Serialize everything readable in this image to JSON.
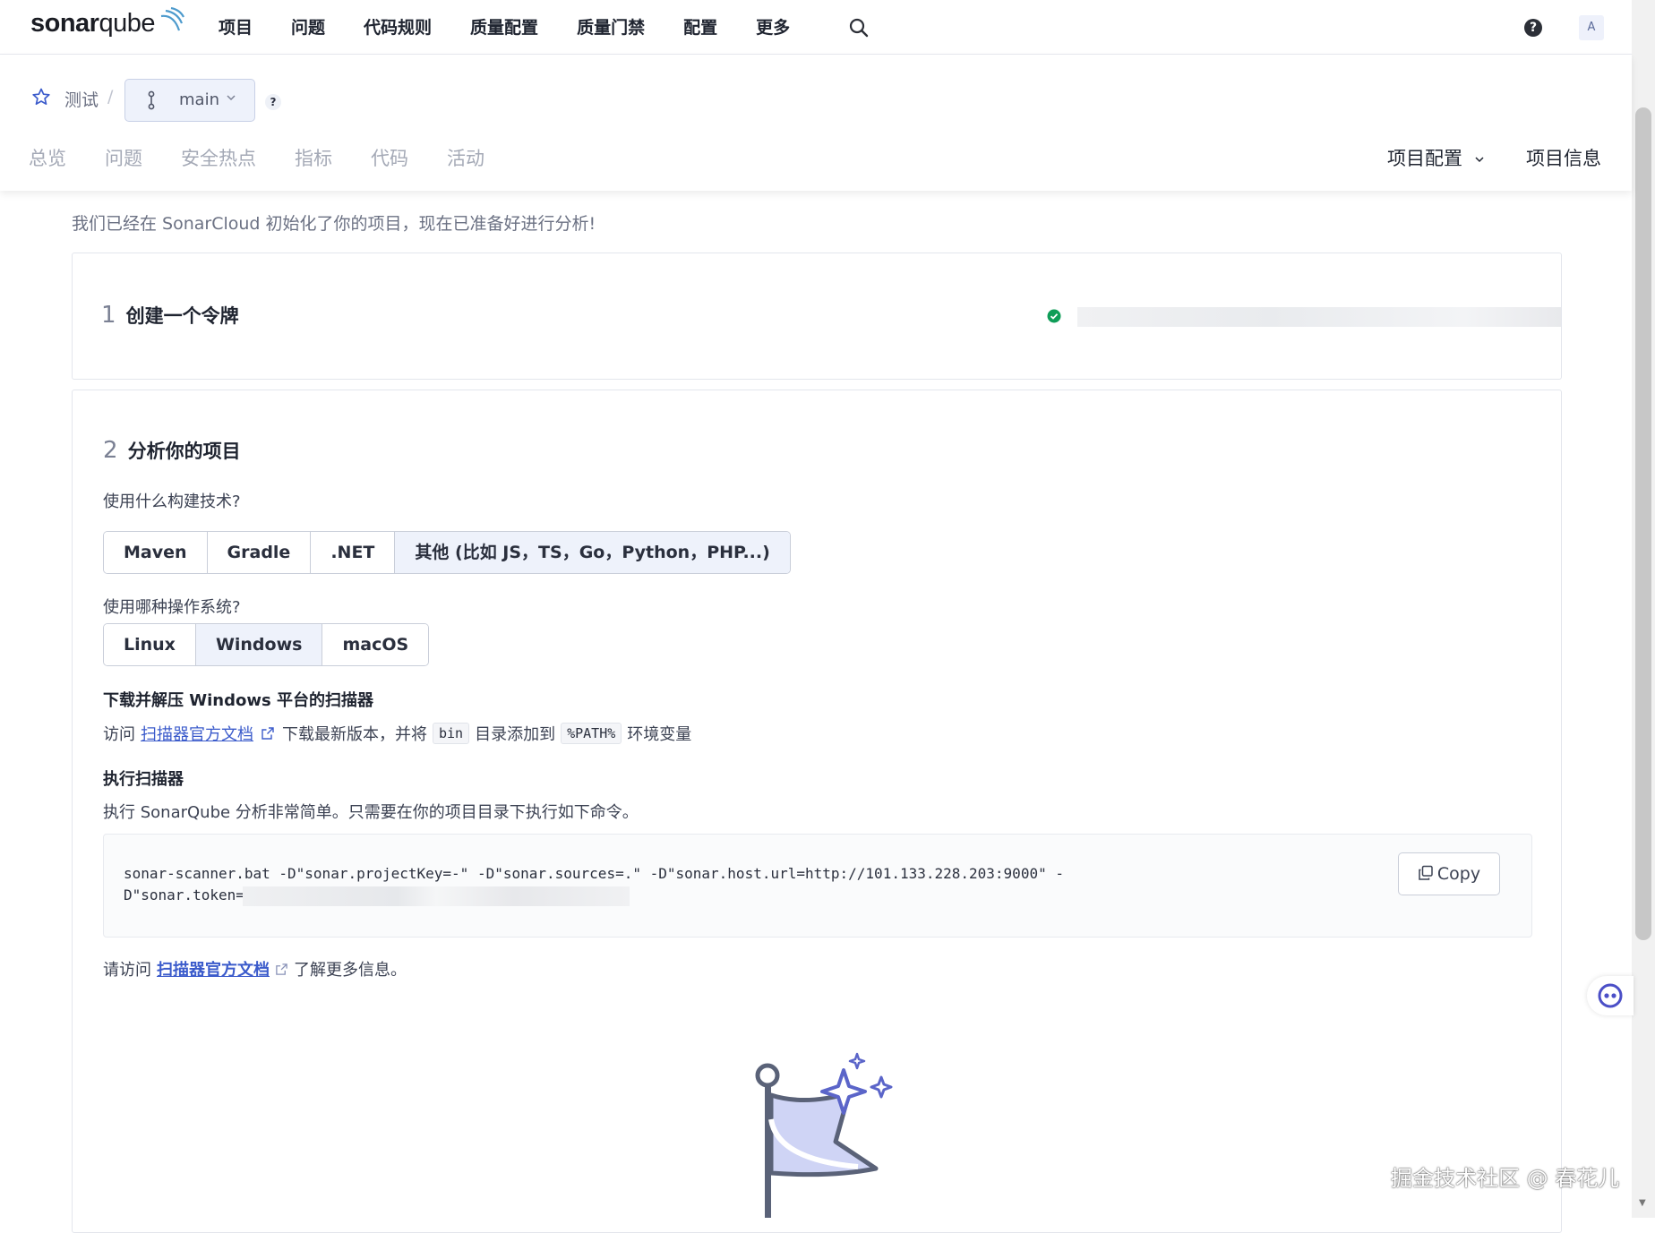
{
  "app": {
    "logo_text_bold": "sonar",
    "logo_text_light": "qube"
  },
  "topnav": {
    "items": [
      "项目",
      "问题",
      "代码规则",
      "质量配置",
      "质量门禁",
      "配置",
      "更多"
    ],
    "avatar": "A"
  },
  "project": {
    "name": "测试",
    "branch": "main",
    "help_mark": "?",
    "tabs": [
      "总览",
      "问题",
      "安全热点",
      "指标",
      "代码",
      "活动"
    ],
    "config_label": "项目配置",
    "info_label": "项目信息"
  },
  "intro": "我们已经在 SonarCloud 初始化了你的项目，现在已准备好进行分析!",
  "step1": {
    "num": "1",
    "title": "创建一个令牌"
  },
  "step2": {
    "num": "2",
    "title": "分析你的项目",
    "build_question": "使用什么构建技术?",
    "build_options": [
      "Maven",
      "Gradle",
      ".NET",
      "其他 (比如 JS，TS，Go，Python，PHP...)"
    ],
    "build_selected": "其他 (比如 JS，TS，Go，Python，PHP...)",
    "os_question": "使用哪种操作系统?",
    "os_options": [
      "Linux",
      "Windows",
      "macOS"
    ],
    "os_selected": "Windows",
    "download_title": "下载并解压 Windows 平台的扫描器",
    "download_prefix": "访问",
    "download_link": "扫描器官方文档",
    "download_mid": "下载最新版本，并将",
    "download_code1": "bin",
    "download_mid2": "目录添加到",
    "download_code2": "%PATH%",
    "download_suffix": "环境变量",
    "run_title": "执行扫描器",
    "run_text": "执行 SonarQube 分析非常简单。只需要在你的项目目录下执行如下命令。",
    "command_line1": "sonar-scanner.bat -D\"sonar.projectKey=-\" -D\"sonar.sources=.\" -D\"sonar.host.url=http://101.133.228.203:9000\" -",
    "command_line2": "D\"sonar.token=",
    "copy_label": "Copy",
    "more_prefix": "请访问",
    "more_link": "扫描器官方文档",
    "more_suffix": "了解更多信息。"
  },
  "watermark": "掘金技术社区 @ 春花儿",
  "colors": {
    "accent": "#3b5bcb",
    "success": "#0f9d58",
    "selected_bg": "#eef2fb"
  }
}
